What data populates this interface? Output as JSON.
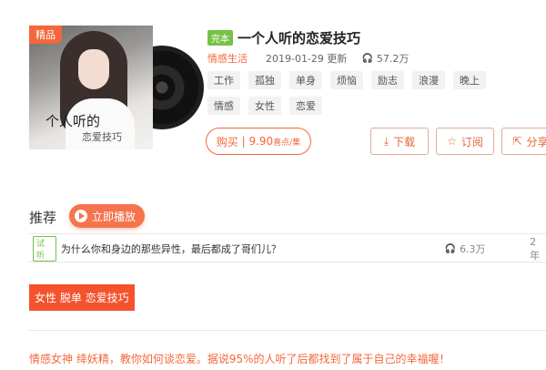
{
  "album": {
    "cover_badge": "精品",
    "cover_text_line1": "个人听的",
    "cover_text_line2": "恋爱技巧",
    "status_tag": "完本",
    "title": "一个人听的恋爱技巧",
    "category": "情感生活",
    "date": "2019-01-29 更新",
    "play_count": "57.2万",
    "tags": [
      "工作",
      "孤独",
      "单身",
      "烦恼",
      "励志",
      "浪漫",
      "晚上",
      "情感",
      "女性",
      "恋爱"
    ]
  },
  "actions": {
    "buy_label": "购买",
    "buy_price": "9.90",
    "buy_unit": "喜点/集",
    "download_label": "下载",
    "subscribe_label": "订阅",
    "share_label": "分享"
  },
  "recommend": {
    "heading": "推荐",
    "play_button": "立即播放"
  },
  "track": {
    "trial_badge": "试听",
    "title": "为什么你和身边的那些异性，最后都成了哥们儿？",
    "plays": "6.3万",
    "time": "2年"
  },
  "intro": {
    "banner": "女性 脱单 恋爱技巧",
    "description": "情感女神 绛妖精，教你如何谈恋爱。据说95%的人听了后都找到了属于自己的幸福喔！"
  },
  "colors": {
    "accent": "#f4673a",
    "green": "#75c247"
  }
}
